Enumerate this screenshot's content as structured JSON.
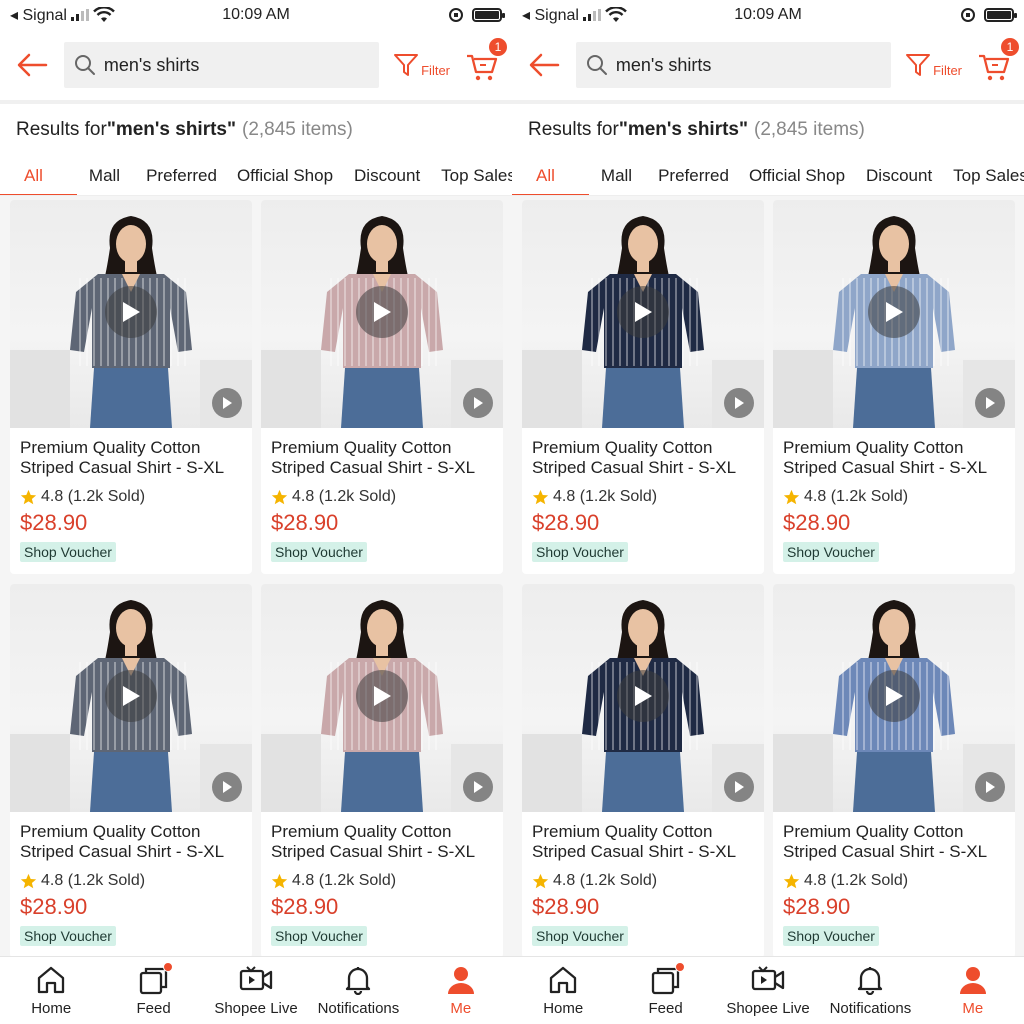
{
  "status_bar": {
    "carrier": "◂ Signal",
    "time": "10:09 AM"
  },
  "search": {
    "query": "men's shirts",
    "filter_label": "Filter",
    "cart_count": "1"
  },
  "results": {
    "prefix": "Results for ",
    "query": "\"men's shirts\"",
    "count": "(2,845 items)"
  },
  "tabs": [
    "All",
    "Mall",
    "Preferred",
    "Official Shop",
    "Discount",
    "Top Sales"
  ],
  "product": {
    "title_line1": "Premium Quality Cotton",
    "title_line2": "Striped Casual Shirt - S-XL",
    "rating": "4.8 (1.2k Sold)",
    "price": "$28.90",
    "voucher": "Shop Voucher"
  },
  "shirt_colors": {
    "left": [
      "#5e6675",
      "#c9a8aa",
      "#5e6675",
      "#c9a8aa"
    ],
    "right": [
      "#1f2a44",
      "#8fa6c9",
      "#1f2a44",
      "#6d88b8"
    ]
  },
  "colors": {
    "accent": "#ee4d2d",
    "price": "#d9402b",
    "voucher_bg": "#d4f1e8",
    "star": "#f5b400"
  },
  "bottom_nav": [
    {
      "label": "Home",
      "icon": "home-icon"
    },
    {
      "label": "Feed",
      "icon": "feed-icon"
    },
    {
      "label": "Shopee Live",
      "icon": "live-video-icon"
    },
    {
      "label": "Notifications",
      "icon": "bell-icon"
    },
    {
      "label": "Me",
      "icon": "profile-icon",
      "active": true
    }
  ]
}
